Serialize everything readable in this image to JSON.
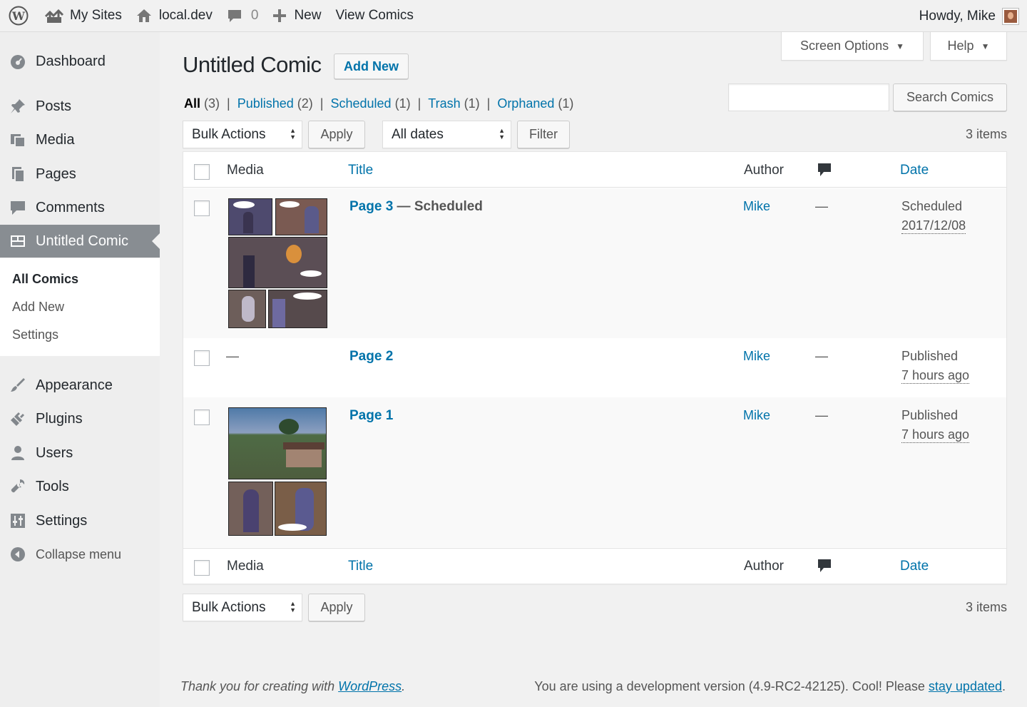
{
  "adminbar": {
    "my_sites": "My Sites",
    "site_name": "local.dev",
    "comments_count": "0",
    "new": "New",
    "view_comics": "View Comics",
    "howdy": "Howdy, Mike"
  },
  "sidebar": {
    "items": [
      {
        "label": "Dashboard",
        "icon": "dashboard-icon"
      },
      {
        "label": "Posts",
        "icon": "pin-icon"
      },
      {
        "label": "Media",
        "icon": "media-icon"
      },
      {
        "label": "Pages",
        "icon": "pages-icon"
      },
      {
        "label": "Comments",
        "icon": "comment-icon"
      },
      {
        "label": "Untitled Comic",
        "icon": "comic-icon"
      },
      {
        "label": "Appearance",
        "icon": "brush-icon"
      },
      {
        "label": "Plugins",
        "icon": "plug-icon"
      },
      {
        "label": "Users",
        "icon": "user-icon"
      },
      {
        "label": "Tools",
        "icon": "wrench-icon"
      },
      {
        "label": "Settings",
        "icon": "settings-icon"
      },
      {
        "label": "Collapse menu",
        "icon": "collapse-icon"
      }
    ],
    "submenu": [
      "All Comics",
      "Add New",
      "Settings"
    ]
  },
  "header": {
    "title": "Untitled Comic",
    "add_new": "Add New",
    "screen_options": "Screen Options",
    "help": "Help"
  },
  "filters": {
    "all": "All",
    "all_count": "(3)",
    "published": "Published",
    "published_count": "(2)",
    "scheduled": "Scheduled",
    "scheduled_count": "(1)",
    "trash": "Trash",
    "trash_count": "(1)",
    "orphaned": "Orphaned",
    "orphaned_count": "(1)",
    "search_button": "Search Comics",
    "search_value": "",
    "bulk_actions": "Bulk Actions",
    "apply": "Apply",
    "all_dates": "All dates",
    "filter": "Filter",
    "items": "3 items"
  },
  "table": {
    "columns": {
      "media": "Media",
      "title": "Title",
      "author": "Author",
      "date": "Date"
    },
    "rows": [
      {
        "title": "Page 3",
        "state": " — Scheduled",
        "author": "Mike",
        "comments": "—",
        "date_status": "Scheduled",
        "date": "2017/12/08",
        "media": ""
      },
      {
        "title": "Page 2",
        "state": "",
        "author": "Mike",
        "comments": "—",
        "date_status": "Published",
        "date": "7 hours ago",
        "media": "—"
      },
      {
        "title": "Page 1",
        "state": "",
        "author": "Mike",
        "comments": "—",
        "date_status": "Published",
        "date": "7 hours ago",
        "media": ""
      }
    ]
  },
  "footer": {
    "thanks_prefix": "Thank you for creating with ",
    "wordpress": "WordPress",
    "thanks_suffix": ".",
    "version_prefix": "You are using a development version (4.9-RC2-42125). Cool! Please ",
    "stay_updated": "stay updated",
    "version_suffix": "."
  }
}
